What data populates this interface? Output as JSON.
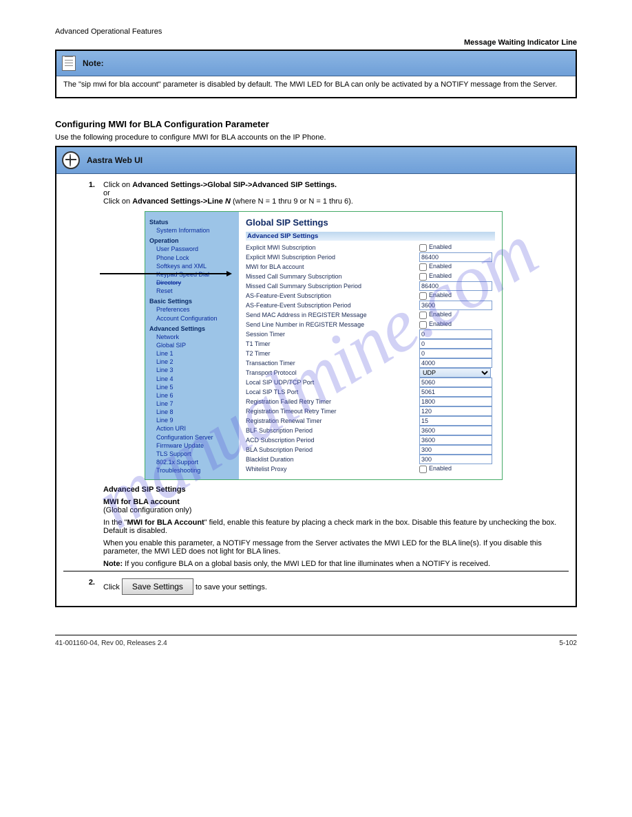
{
  "header": {
    "path_prefix": "Advanced Operational Features",
    "path_suffix": "Message Waiting Indicator Line"
  },
  "notebox": {
    "title": "Note:",
    "text": "The \"sip mwi for bla account\" parameter is disabled by default. The MWI LED for BLA can only be activated by a NOTIFY message from the Server."
  },
  "section_heading": "Configuring MWI for BLA Configuration Parameter",
  "section_intro": "Use the following procedure to configure MWI for BLA accounts on the IP Phone.",
  "webui_bar": "Aastra Web UI",
  "step1": {
    "num": "1.",
    "line": "Click on",
    "bold": "Advanced Settings->Global SIP->Advanced SIP Settings.",
    "or_line": "or",
    "line2_pre": "Click on",
    "line2_bold": "Advanced Settings->Line",
    "line2_mid": "N",
    "line2_post": " (where N = 1 thru 9 or N = 1 thru 6)."
  },
  "screenshot": {
    "sidebar": {
      "groups": [
        {
          "label": "Status",
          "items": [
            "System Information"
          ]
        },
        {
          "label": "Operation",
          "items": [
            "User Password",
            "Phone Lock",
            "Softkeys and XML",
            "Keypad Speed Dial",
            "Directory",
            "Reset"
          ]
        },
        {
          "label": "Basic Settings",
          "items": [
            "Preferences",
            "Account Configuration"
          ]
        },
        {
          "label": "Advanced Settings",
          "items": [
            "Network",
            "Global SIP",
            "Line 1",
            "Line 2",
            "Line 3",
            "Line 4",
            "Line 5",
            "Line 6",
            "Line 7",
            "Line 8",
            "Line 9",
            "Action URI",
            "Configuration Server",
            "Firmware Update",
            "TLS Support",
            "802.1x Support",
            "Troubleshooting"
          ]
        }
      ]
    },
    "content": {
      "title": "Global SIP Settings",
      "subhead": "Advanced SIP Settings",
      "rows": [
        {
          "label": "Explicit MWI Subscription",
          "type": "check",
          "value": false,
          "enabled_label": "Enabled"
        },
        {
          "label": "Explicit MWI Subscription Period",
          "type": "text",
          "value": "86400"
        },
        {
          "label": "MWI for BLA account",
          "type": "check",
          "value": false,
          "enabled_label": "Enabled"
        },
        {
          "label": "Missed Call Summary Subscription",
          "type": "check",
          "value": false,
          "enabled_label": "Enabled"
        },
        {
          "label": "Missed Call Summary Subscription Period",
          "type": "text",
          "value": "86400"
        },
        {
          "label": "AS-Feature-Event Subscription",
          "type": "check",
          "value": false,
          "enabled_label": "Enabled"
        },
        {
          "label": "AS-Feature-Event Subscription Period",
          "type": "text",
          "value": "3600"
        },
        {
          "label": "Send MAC Address in REGISTER Message",
          "type": "check",
          "value": false,
          "enabled_label": "Enabled"
        },
        {
          "label": "Send Line Number in REGISTER Message",
          "type": "check",
          "value": false,
          "enabled_label": "Enabled"
        },
        {
          "label": "Session Timer",
          "type": "text",
          "value": "0"
        },
        {
          "label": "T1 Timer",
          "type": "text",
          "value": "0"
        },
        {
          "label": "T2 Timer",
          "type": "text",
          "value": "0"
        },
        {
          "label": "Transaction Timer",
          "type": "text",
          "value": "4000"
        },
        {
          "label": "Transport Protocol",
          "type": "select",
          "value": "UDP"
        },
        {
          "label": "Local SIP UDP/TCP Port",
          "type": "text",
          "value": "5060"
        },
        {
          "label": "Local SIP TLS Port",
          "type": "text",
          "value": "5061"
        },
        {
          "label": "Registration Failed Retry Timer",
          "type": "text",
          "value": "1800"
        },
        {
          "label": "Registration Timeout Retry Timer",
          "type": "text",
          "value": "120"
        },
        {
          "label": "Registration Renewal Timer",
          "type": "text",
          "value": "15"
        },
        {
          "label": "BLF Subscription Period",
          "type": "text",
          "value": "3600"
        },
        {
          "label": "ACD Subscription Period",
          "type": "text",
          "value": "3600"
        },
        {
          "label": "BLA Subscription Period",
          "type": "text",
          "value": "300"
        },
        {
          "label": "Blacklist Duration",
          "type": "text",
          "value": "300"
        },
        {
          "label": "Whitelist Proxy",
          "type": "check",
          "value": false,
          "enabled_label": "Enabled"
        }
      ]
    }
  },
  "advanced_block": {
    "title": "Advanced SIP Settings",
    "field_name": "MWI for BLA account",
    "para1": "(Global configuration only)",
    "para2_pre": "In the \"",
    "para2_bold": "MWI for BLA Account",
    "para2_post": "\" field, enable this feature by placing a check mark in the box. Disable this feature by unchecking the box. Default is disabled.",
    "para3": "When you enable this parameter, a NOTIFY message from the Server activates the MWI LED for the BLA line(s). If you disable this parameter, the MWI LED does not light for BLA lines.",
    "note_bold": "Note:",
    "note_text": " If you configure BLA on a global basis only, the MWI LED for that line illuminates when a NOTIFY is received."
  },
  "step2": {
    "num": "2.",
    "pre": "Click ",
    "btn": "Save Settings",
    "post": " to save your settings."
  },
  "footer": {
    "left": "41-001160-04, Rev 00, Releases 2.4",
    "right": "5-102"
  },
  "watermark": "manualmine.com"
}
